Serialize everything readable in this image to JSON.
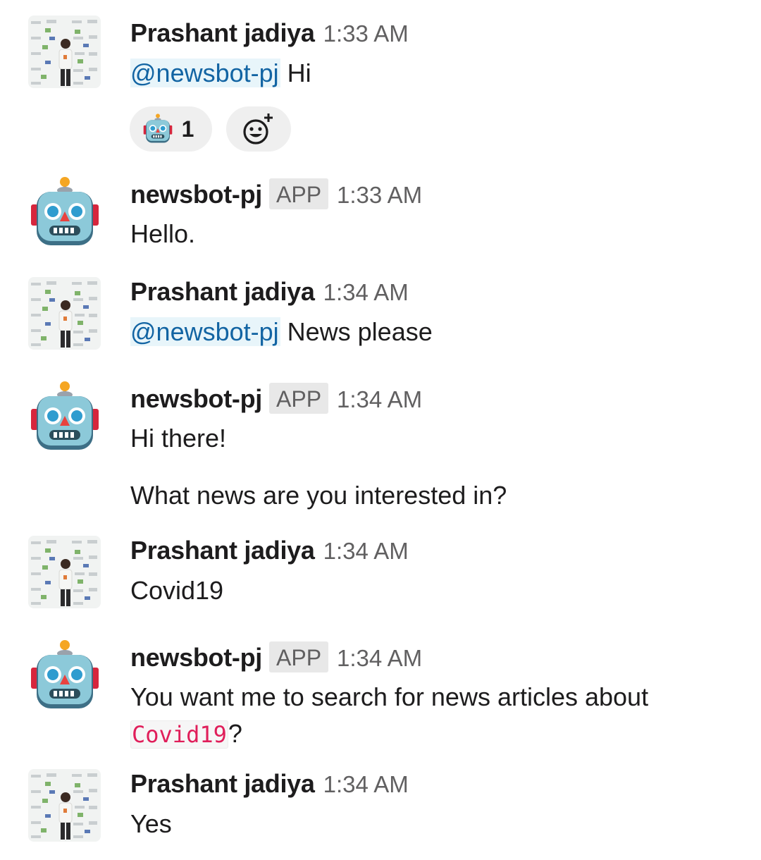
{
  "messages": [
    {
      "author": "Prashant jadiya",
      "time": "1:33 AM",
      "mention": "@newsbot-pj",
      "text": " Hi",
      "reactions": [
        {
          "emoji": "robot-face",
          "count": "1"
        }
      ]
    },
    {
      "author": "newsbot-pj",
      "badge": "APP",
      "time": "1:33 AM",
      "text": "Hello."
    },
    {
      "author": "Prashant jadiya",
      "time": "1:34 AM",
      "mention": "@newsbot-pj",
      "text": " News please"
    },
    {
      "author": "newsbot-pj",
      "badge": "APP",
      "time": "1:34 AM",
      "text": "Hi there!",
      "text2": "What news are you interested in?"
    },
    {
      "author": "Prashant jadiya",
      "time": "1:34 AM",
      "text": "Covid19"
    },
    {
      "author": "newsbot-pj",
      "badge": "APP",
      "time": "1:34 AM",
      "text": "You want me to search for news articles about",
      "code": "Covid19",
      "text_after": "?"
    },
    {
      "author": "Prashant jadiya",
      "time": "1:34 AM",
      "text": "Yes"
    }
  ],
  "colors": {
    "mention_text": "#1264a3",
    "mention_bg": "#e8f5fa",
    "code_text": "#e01e5a",
    "timestamp": "#616061"
  },
  "icons": {
    "user_avatar": "user-photo-avatar",
    "bot_avatar": "robot-face-avatar",
    "add_reaction": "add-reaction-icon"
  }
}
